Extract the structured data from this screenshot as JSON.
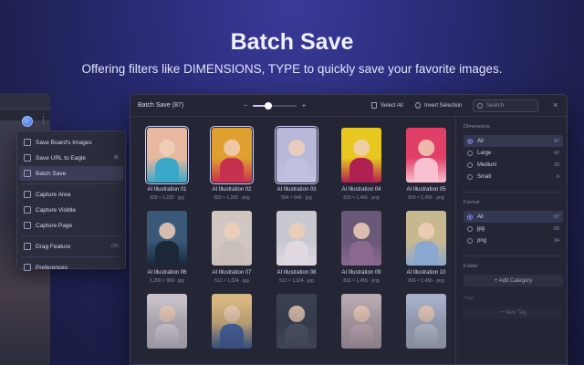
{
  "hero": {
    "title": "Batch Save",
    "subtitle": "Offering filters like DIMENSIONS, TYPE to quickly save your favorite images."
  },
  "colors": {
    "accent": "#7c8cff",
    "panel": "#242636",
    "menu": "#2b2d3d"
  },
  "menu": {
    "items": [
      {
        "label": "Save Board's Images",
        "icon": "images-icon",
        "shortcut": ""
      },
      {
        "label": "Save URL to Eagle",
        "icon": "link-icon",
        "shortcut": "⌘"
      },
      {
        "label": "Batch Save",
        "icon": "folder-icon",
        "shortcut": ""
      },
      {
        "label": "Capture Area",
        "icon": "crop-icon",
        "shortcut": ""
      },
      {
        "label": "Capture Visible",
        "icon": "window-icon",
        "shortcut": ""
      },
      {
        "label": "Capture Page",
        "icon": "page-icon",
        "shortcut": ""
      },
      {
        "label": "Drag Feature",
        "icon": "drag-icon",
        "shortcut": "ON"
      },
      {
        "label": "Preferences",
        "icon": "gear-icon",
        "shortcut": ""
      }
    ],
    "active_index": 2
  },
  "app": {
    "title": "Batch Save (87)",
    "zoom_level": 0.35,
    "zoom_minus": "−",
    "zoom_plus": "+",
    "select_all": "Select All",
    "invert_selection": "Invert Selection",
    "search_placeholder": "Search",
    "close": "×"
  },
  "images": [
    {
      "name": "AI Illustration 01",
      "meta": "928 × 1,232 · jpg",
      "selected": true,
      "bg": "#e8b8a0",
      "body": "#3aa8c8"
    },
    {
      "name": "AI Illustration 02",
      "meta": "683 × 1,200 · png",
      "selected": true,
      "bg": "#e0a030",
      "body": "#c83050"
    },
    {
      "name": "AI Illustration 03",
      "meta": "564 × 846 · jpg",
      "selected": true,
      "bg": "#b8b8d8",
      "body": "#c0c0e0"
    },
    {
      "name": "AI Illustration 04",
      "meta": "816 × 1,456 · png",
      "selected": false,
      "bg": "#e8c820",
      "body": "#b02050"
    },
    {
      "name": "AI Illustration 05",
      "meta": "816 × 1,456 · png",
      "selected": false,
      "bg": "#e04068",
      "body": "#f8c0d0"
    },
    {
      "name": "AI Illustration 06",
      "meta": "1,200 × 900 · jpg",
      "selected": false,
      "bg": "#3a5878",
      "body": "#1a2838"
    },
    {
      "name": "AI Illustration 07",
      "meta": "512 × 1,024 · jpg",
      "selected": false,
      "bg": "#d0c8c0",
      "body": "#c8c0b8"
    },
    {
      "name": "AI Illustration 08",
      "meta": "512 × 1,024 · jpg",
      "selected": false,
      "bg": "#c8c8d0",
      "body": "#e0d8e0"
    },
    {
      "name": "AI Illustration 09",
      "meta": "816 × 1,456 · png",
      "selected": false,
      "bg": "#6a5878",
      "body": "#8a6890"
    },
    {
      "name": "AI Illustration 10",
      "meta": "816 × 1,456 · png",
      "selected": false,
      "bg": "#c8b890",
      "body": "#8aa8d0"
    },
    {
      "name": "",
      "meta": "",
      "selected": false,
      "bg": "#c8c0c8",
      "body": "#e8e0e8"
    },
    {
      "name": "",
      "meta": "",
      "selected": false,
      "bg": "#d8b880",
      "body": "#4868a8"
    },
    {
      "name": "",
      "meta": "",
      "selected": false,
      "bg": "#3a4050",
      "body": "#505868"
    },
    {
      "name": "",
      "meta": "",
      "selected": false,
      "bg": "#b8a8b0",
      "body": "#d0b8c0"
    },
    {
      "name": "",
      "meta": "",
      "selected": false,
      "bg": "#a8b0c8",
      "body": "#c8d0e0"
    }
  ],
  "filters": {
    "dimensions": {
      "title": "Dimensions",
      "options": [
        {
          "label": "All",
          "count": "87",
          "selected": true
        },
        {
          "label": "Large",
          "count": "42",
          "selected": false
        },
        {
          "label": "Medium",
          "count": "39",
          "selected": false
        },
        {
          "label": "Small",
          "count": "6",
          "selected": false
        }
      ]
    },
    "format": {
      "title": "Format",
      "options": [
        {
          "label": "All",
          "count": "87",
          "selected": true
        },
        {
          "label": "jpg",
          "count": "65",
          "selected": false
        },
        {
          "label": "png",
          "count": "34",
          "selected": false
        }
      ]
    },
    "folder": {
      "title": "Folder",
      "add_label": "+ Add Category"
    },
    "tags": {
      "title": "Tags",
      "add_label": "+ New Tag"
    }
  }
}
